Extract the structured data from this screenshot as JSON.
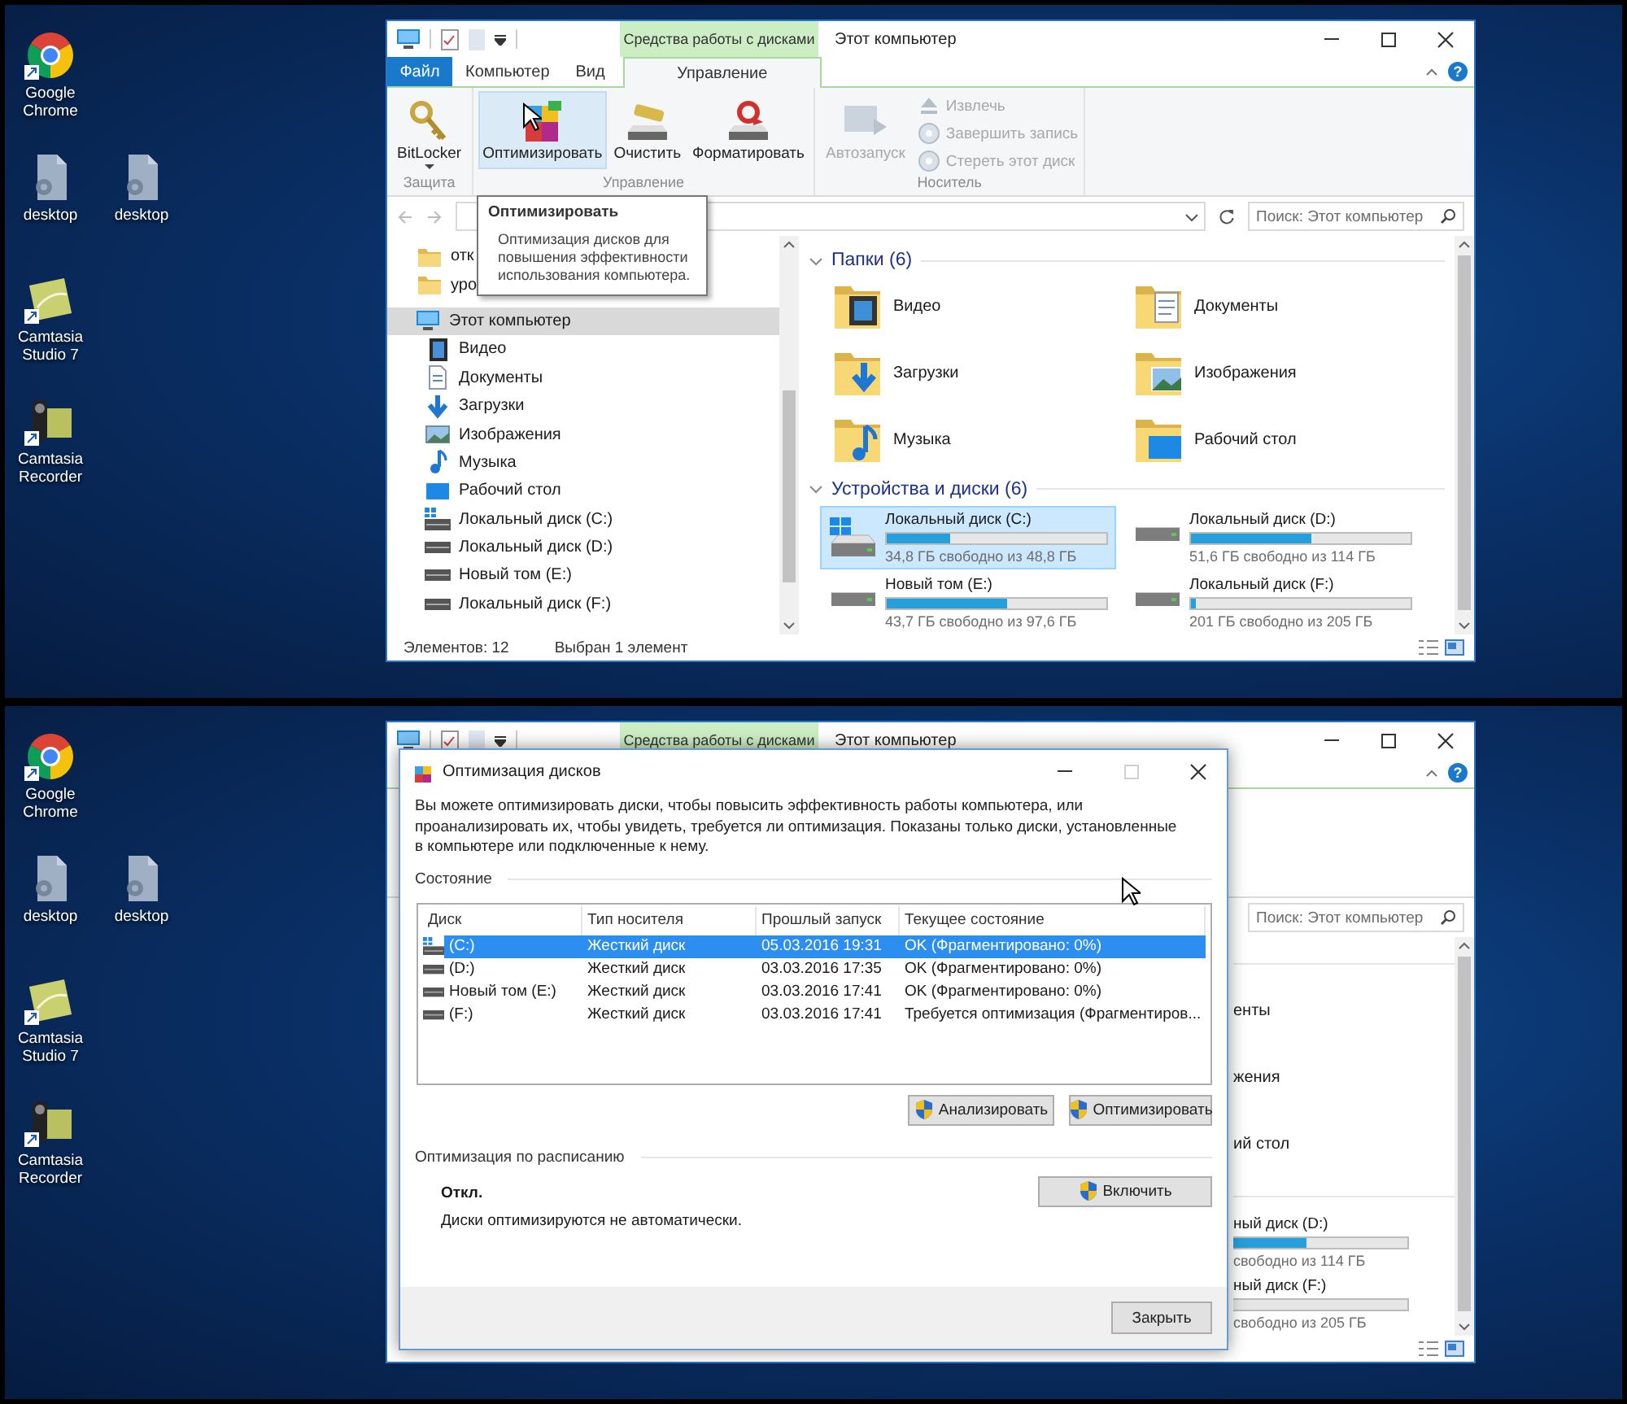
{
  "top_screen": {
    "desktop_icons": [
      {
        "icons": [
          {
            "label": "Google Chrome",
            "kind": "browser",
            "shortcut": true
          }
        ]
      },
      {
        "icons": [
          {
            "label": "desktop",
            "kind": "file",
            "shortcut": false
          },
          {
            "label": "desktop",
            "kind": "file",
            "shortcut": false
          }
        ]
      },
      {
        "icons": [
          {
            "label": "Camtasia Studio 7",
            "kind": "camtasia",
            "shortcut": true
          }
        ]
      },
      {
        "icons": [
          {
            "label": "Camtasia Recorder",
            "kind": "recorder",
            "shortcut": true
          }
        ]
      }
    ],
    "explorer": {
      "context_tab": "Средства работы с дисками",
      "title": "Этот компьютер",
      "help": "?",
      "tabs": [
        {
          "label": "Файл",
          "kind": "file",
          "selected": false
        },
        {
          "label": "Компьютер",
          "kind": "plain",
          "selected": false
        },
        {
          "label": "Вид",
          "kind": "plain",
          "selected": false
        },
        {
          "label": "Управление",
          "kind": "context",
          "selected": true
        }
      ],
      "ribbon_groups": [
        {
          "label": "Защита",
          "buttons": [
            {
              "label": "BitLocker",
              "kind": "bitlocker",
              "dropdown": true,
              "highlighted": false,
              "disabled": false
            }
          ]
        },
        {
          "label": "Управление",
          "buttons": [
            {
              "label": "Оптимизировать",
              "kind": "optimize",
              "dropdown": false,
              "highlighted": true,
              "disabled": false
            },
            {
              "label": "Очистить",
              "kind": "cleanup",
              "dropdown": false,
              "highlighted": false,
              "disabled": false
            },
            {
              "label": "Форматировать",
              "kind": "format",
              "dropdown": false,
              "highlighted": false,
              "disabled": false
            }
          ]
        },
        {
          "label": "Носитель",
          "buttons": [
            {
              "label": "Автозапуск",
              "kind": "autoplay",
              "dropdown": false,
              "highlighted": false,
              "disabled": true
            }
          ],
          "small_buttons": [
            {
              "label": "Извлечь",
              "kind": "eject",
              "disabled": true
            },
            {
              "label": "Завершить запись",
              "kind": "finish",
              "disabled": true
            },
            {
              "label": "Стереть этот диск",
              "kind": "erase",
              "disabled": true
            }
          ]
        }
      ],
      "search_placeholder": "Поиск: Этот компьютер",
      "tooltip": {
        "title": "Оптимизировать",
        "text": "Оптимизация дисков для повышения эффективности использования компьютера."
      },
      "nav_items": [
        {
          "label": "отк",
          "kind": "folder",
          "selected": false
        },
        {
          "label": "уро",
          "kind": "folder",
          "selected": false
        },
        {
          "label": "Этот компьютер",
          "kind": "pc",
          "selected": true,
          "children": [
            {
              "label": "Видео",
              "kind": "video",
              "selected": false
            },
            {
              "label": "Документы",
              "kind": "documents",
              "selected": false
            },
            {
              "label": "Загрузки",
              "kind": "downloads",
              "selected": false
            },
            {
              "label": "Изображения",
              "kind": "pictures",
              "selected": false
            },
            {
              "label": "Музыка",
              "kind": "music",
              "selected": false
            },
            {
              "label": "Рабочий стол",
              "kind": "desktop",
              "selected": false
            },
            {
              "label": "Локальный диск (C:)",
              "kind": "system",
              "selected": false
            },
            {
              "label": "Локальный диск (D:)",
              "kind": "drive",
              "selected": false
            },
            {
              "label": "Новый том (E:)",
              "kind": "drive",
              "selected": false
            },
            {
              "label": "Локальный диск (F:)",
              "kind": "drive",
              "selected": false
            }
          ]
        }
      ],
      "sections": [
        {
          "header": "Папки (6)",
          "kind": "folders",
          "expanded": true,
          "items": [
            {
              "label": "Видео",
              "kind": "video"
            },
            {
              "label": "Документы",
              "kind": "documents"
            },
            {
              "label": "Загрузки",
              "kind": "downloads"
            },
            {
              "label": "Изображения",
              "kind": "pictures"
            },
            {
              "label": "Музыка",
              "kind": "music"
            },
            {
              "label": "Рабочий стол",
              "kind": "desktop"
            }
          ]
        },
        {
          "header": "Устройства и диски (6)",
          "kind": "drives",
          "expanded": true,
          "items": [
            {
              "name": "Локальный диск (C:)",
              "kind": "system",
              "level": 0.29,
              "free": "34,8 ГБ свободно из 48,8 ГБ",
              "selected": true
            },
            {
              "name": "Локальный диск (D:)",
              "kind": "drive",
              "level": 0.55,
              "free": "51,6 ГБ свободно из 114 ГБ",
              "selected": false
            },
            {
              "name": "Новый том (E:)",
              "kind": "drive",
              "level": 0.55,
              "free": "43,7 ГБ свободно из 97,6 ГБ",
              "selected": false
            },
            {
              "name": "Локальный диск (F:)",
              "kind": "drive",
              "level": 0.02,
              "free": "201 ГБ свободно из 205 ГБ",
              "selected": false
            }
          ]
        }
      ],
      "status": [
        "Элементов: 12",
        "Выбран 1 элемент"
      ]
    }
  },
  "bottom_screen": {
    "desktop_icons": [
      {
        "icons": [
          {
            "label": "Google Chrome",
            "kind": "browser",
            "shortcut": true
          }
        ]
      },
      {
        "icons": [
          {
            "label": "desktop",
            "kind": "file",
            "shortcut": false
          },
          {
            "label": "desktop",
            "kind": "file",
            "shortcut": false
          }
        ]
      },
      {
        "icons": [
          {
            "label": "Camtasia Studio 7",
            "kind": "camtasia",
            "shortcut": true
          }
        ]
      },
      {
        "icons": [
          {
            "label": "Camtasia Recorder",
            "kind": "recorder",
            "shortcut": true
          }
        ]
      }
    ],
    "explorer": {
      "context_tab": "Средства работы с дисками",
      "title": "Этот компьютер",
      "help": "?",
      "search_placeholder": "Поиск: Этот компьютер",
      "folder_fragments": [
        "енты",
        "жения",
        "ий стол"
      ],
      "drive_fragments": [
        {
          "name": "ный диск (D:)",
          "level": 0.42,
          "free": "свободно из 114 ГБ"
        },
        {
          "name": "ный диск (F:)",
          "level": 0,
          "free": "свободно из 205 ГБ"
        }
      ]
    },
    "dialog": {
      "title": "Оптимизация дисков",
      "maximize_disabled": true,
      "description": "Вы можете оптимизировать диски, чтобы повысить эффективность работы  компьютера, или проанализировать их, чтобы увидеть, требуется ли оптимизация. Показаны только диски, установленные в компьютере или подключенные к нему.",
      "status_section": "Состояние",
      "columns": [
        "Диск",
        "Тип носителя",
        "Прошлый запуск",
        "Текущее состояние"
      ],
      "rows": [
        {
          "kind": "system",
          "selected": true,
          "cells": [
            "(C:)",
            "Жесткий диск",
            "05.03.2016 19:31",
            "OK (Фрагментировано: 0%)"
          ]
        },
        {
          "kind": "drive",
          "selected": false,
          "cells": [
            "(D:)",
            "Жесткий диск",
            "03.03.2016 17:35",
            "OK (Фрагментировано: 0%)"
          ]
        },
        {
          "kind": "drive",
          "selected": false,
          "cells": [
            "Новый том (E:)",
            "Жесткий диск",
            "03.03.2016 17:41",
            "OK (Фрагментировано: 0%)"
          ]
        },
        {
          "kind": "drive",
          "selected": false,
          "cells": [
            "(F:)",
            "Жесткий диск",
            "03.03.2016 17:41",
            "Требуется оптимизация (Фрагментиров..."
          ]
        }
      ],
      "actions": [
        {
          "label": "Анализировать",
          "shield": true
        },
        {
          "label": "Оптимизировать",
          "shield": true
        }
      ],
      "schedule_section": "Оптимизация по расписанию",
      "schedule_state": "Откл.",
      "schedule_text": "Диски оптимизируются не автоматически.",
      "schedule_button": {
        "label": "Включить",
        "shield": true
      },
      "close_button": "Закрыть"
    }
  }
}
